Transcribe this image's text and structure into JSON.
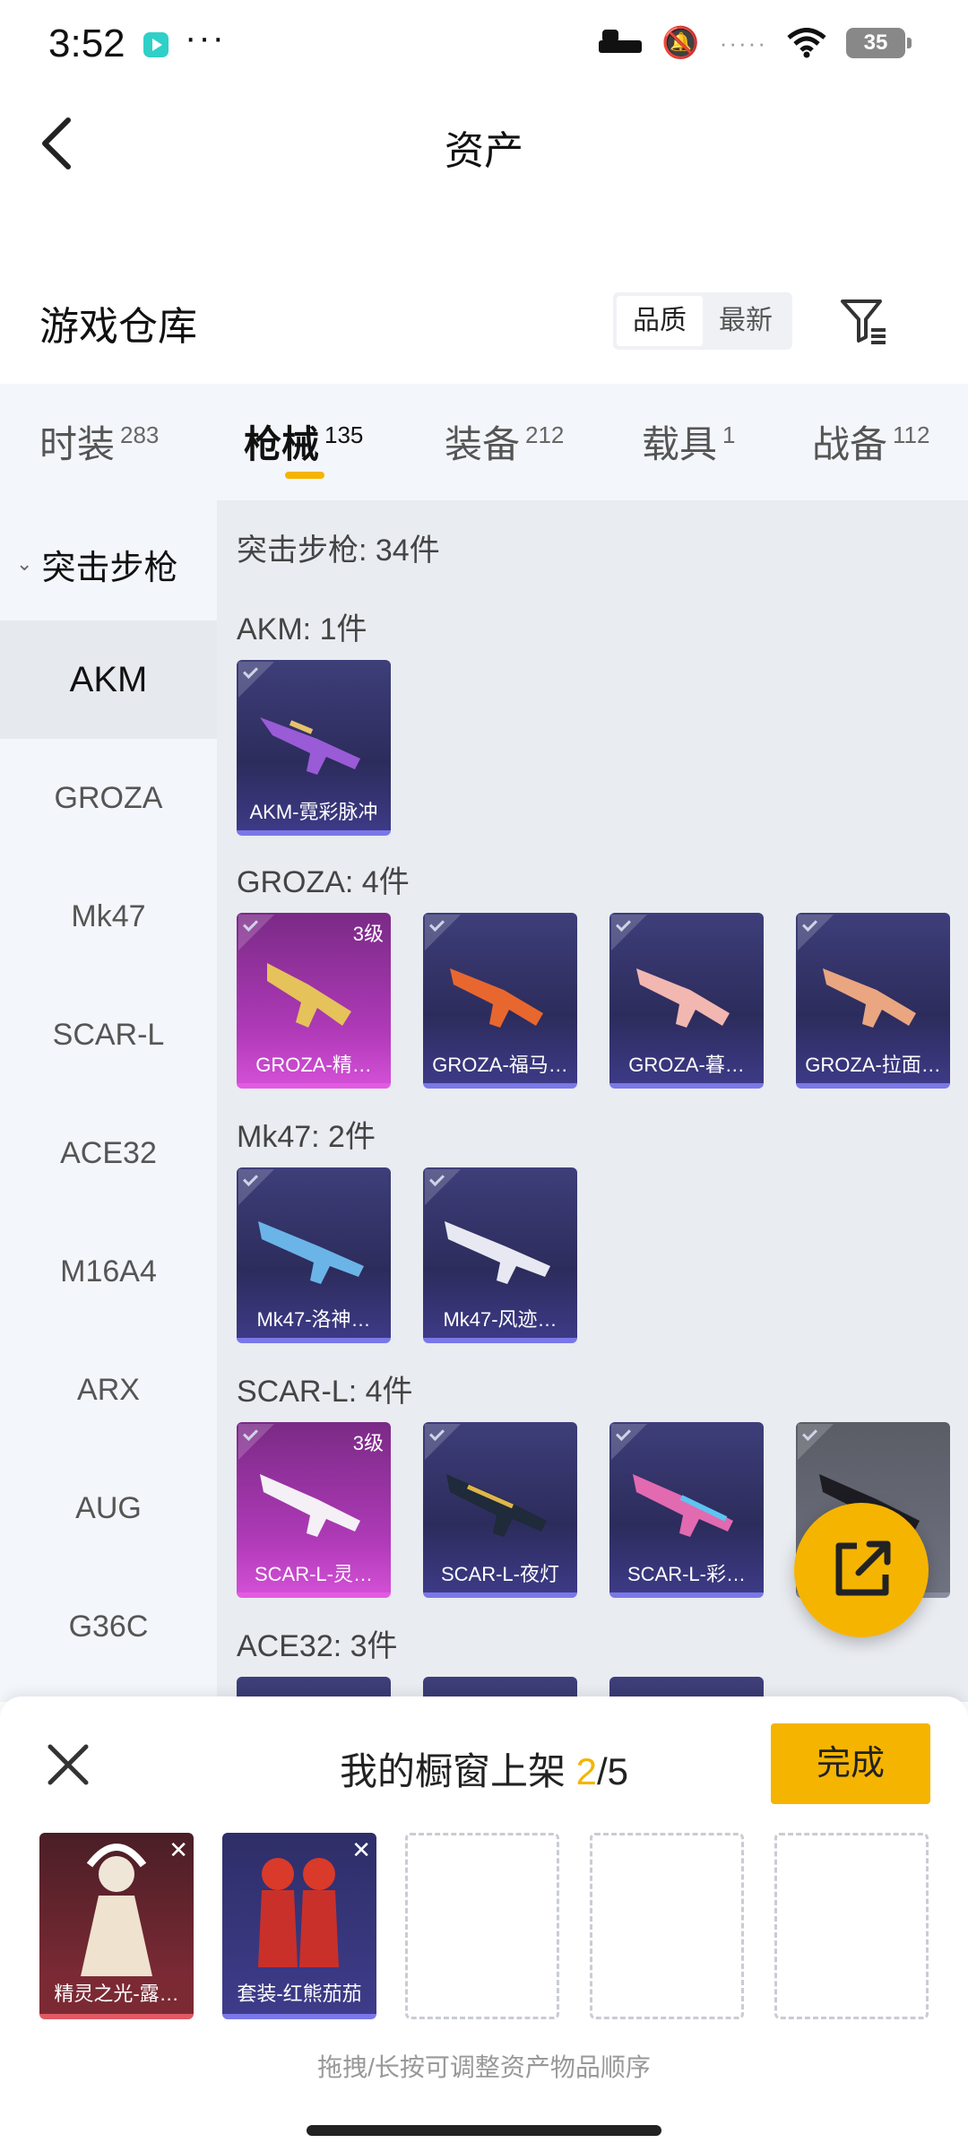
{
  "status_bar": {
    "time": "3:52",
    "more": "···",
    "signal_dots": "·····",
    "battery": "35",
    "icons": [
      "app-icon",
      "bed-icon",
      "mute-bell-icon",
      "wifi-icon",
      "battery-icon"
    ]
  },
  "header": {
    "title": "资产",
    "back_icon": "back-arrow-icon"
  },
  "warehouse": {
    "title": "游戏仓库",
    "sort": [
      "品质",
      "最新"
    ],
    "active_sort": "品质",
    "filter_icon": "filter-icon"
  },
  "tabs": [
    {
      "label": "时装",
      "count": "283"
    },
    {
      "label": "枪械",
      "count": "135"
    },
    {
      "label": "装备",
      "count": "212"
    },
    {
      "label": "载具",
      "count": "1"
    },
    {
      "label": "战备",
      "count": "112"
    }
  ],
  "active_tab": "枪械",
  "sidebar": {
    "group": "突击步枪",
    "items": [
      "AKM",
      "GROZA",
      "Mk47",
      "SCAR-L",
      "ACE32",
      "M16A4",
      "ARX",
      "AUG",
      "G36C"
    ],
    "active": "AKM"
  },
  "content": {
    "header": "突击步枪: 34件",
    "sections": [
      {
        "title": "AKM: 1件",
        "items": [
          {
            "name": "AKM-霓彩脉冲",
            "level": ""
          }
        ]
      },
      {
        "title": "GROZA: 4件",
        "items": [
          {
            "name": "GROZA-精…",
            "level": "3级"
          },
          {
            "name": "GROZA-福马…",
            "level": ""
          },
          {
            "name": "GROZA-暮…",
            "level": ""
          },
          {
            "name": "GROZA-拉面…",
            "level": ""
          }
        ]
      },
      {
        "title": "Mk47: 2件",
        "items": [
          {
            "name": "Mk47-洛神…",
            "level": ""
          },
          {
            "name": "Mk47-风迹…",
            "level": ""
          }
        ]
      },
      {
        "title": "SCAR-L: 4件",
        "items": [
          {
            "name": "SCAR-L-灵…",
            "level": "3级"
          },
          {
            "name": "SCAR-L-夜灯",
            "level": ""
          },
          {
            "name": "SCAR-L-彩…",
            "level": ""
          },
          {
            "name": "…",
            "level": ""
          }
        ]
      },
      {
        "title": "ACE32: 3件",
        "items": []
      }
    ]
  },
  "share_icon": "share-icon",
  "showcase": {
    "title": "我的橱窗上架",
    "count_current": "2",
    "count_total": "/5",
    "done": "完成",
    "close_icon": "close-icon",
    "slots": [
      "精灵之光-露…",
      "套装-红熊茄茄",
      "",
      "",
      ""
    ],
    "hint": "拖拽/长按可调整资产物品顺序"
  },
  "colors": {
    "accent": "#f5b400",
    "tab_bg": "#f3f6fb",
    "content_bg": "#e9ecf1"
  }
}
